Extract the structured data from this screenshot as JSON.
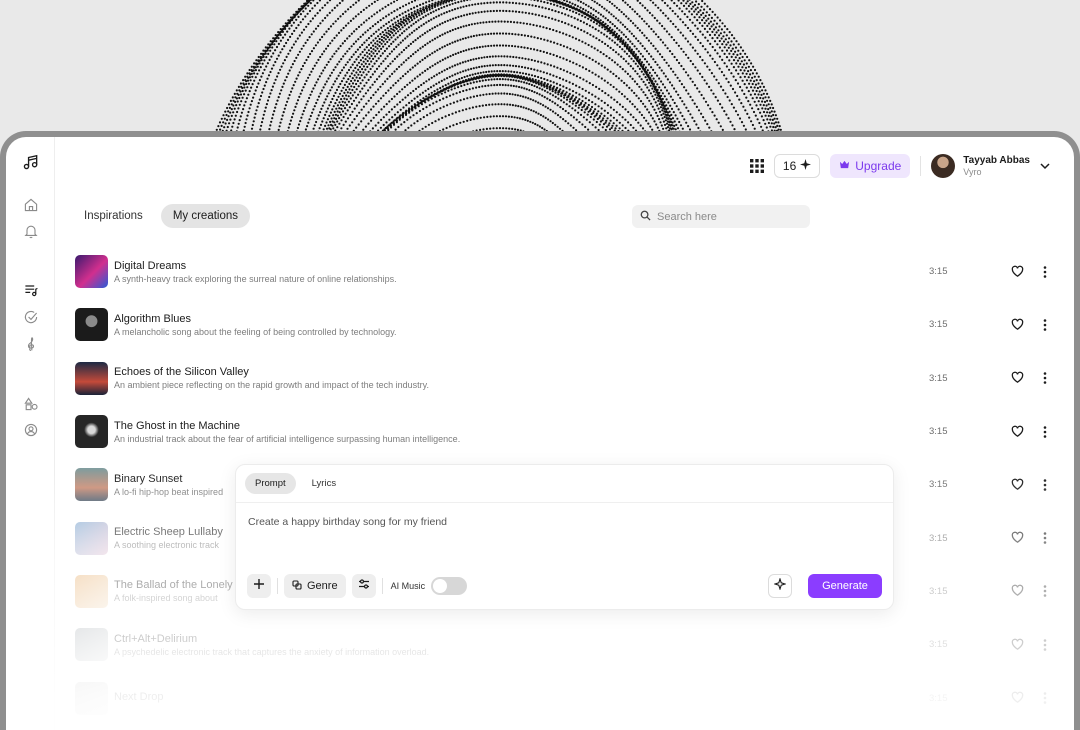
{
  "topbar": {
    "credits": "16",
    "upgrade_label": "Upgrade",
    "user_name": "Tayyab Abbas",
    "user_org": "Vyro"
  },
  "tabs": [
    {
      "label": "Inspirations",
      "active": false
    },
    {
      "label": "My creations",
      "active": true
    }
  ],
  "search": {
    "placeholder": "Search here"
  },
  "songs": [
    {
      "title": "Digital Dreams",
      "desc": "A synth-heavy track exploring the surreal nature of online relationships.",
      "duration": "3:15",
      "cover": "linear-gradient(135deg,#3a1a6e,#d12f8e 55%,#2a5bd7)"
    },
    {
      "title": "Algorithm Blues",
      "desc": "A melancholic song about the feeling of being controlled by technology.",
      "duration": "3:15",
      "cover": "radial-gradient(circle at 50% 40%,#8a8a8a 0 22%,#1b1b1b 24% 100%)"
    },
    {
      "title": "Echoes of the Silicon Valley",
      "desc": "An ambient piece reflecting on the rapid growth and impact of the tech industry.",
      "duration": "3:15",
      "cover": "linear-gradient(180deg,#1d2a44,#c44a3a 60%,#1a2238)"
    },
    {
      "title": "The Ghost in the Machine",
      "desc": "An industrial track about the fear of artificial intelligence surpassing human intelligence.",
      "duration": "3:15",
      "cover": "radial-gradient(circle at 50% 45%,#d8d8d8 0 15%,#262626 30% 100%)"
    },
    {
      "title": "Binary Sunset",
      "desc": "A lo-fi hip-hop beat inspired",
      "duration": "3:15",
      "cover": "linear-gradient(180deg,#7f9ea0,#c98d76 60%,#4d5b6a)"
    },
    {
      "title": "Electric Sheep Lullaby",
      "desc": "A soothing electronic track",
      "duration": "3:15",
      "cover": "linear-gradient(135deg,#8fb3d6,#e4c7d7)"
    },
    {
      "title": "The Ballad of the Lonely",
      "desc": "A folk-inspired song about",
      "duration": "3:15",
      "cover": "linear-gradient(135deg,#e8b070,#f2dcc0)"
    },
    {
      "title": "Ctrl+Alt+Delirium",
      "desc": "A psychedelic electronic track that captures the anxiety of information overload.",
      "duration": "3:15",
      "cover": "linear-gradient(135deg,#9aa2a8,#d8dadb)"
    },
    {
      "title": "Next Drop",
      "desc": "",
      "duration": "3:15",
      "cover": "linear-gradient(135deg,#b8b8b8,#e2e2e2)"
    }
  ],
  "composer": {
    "tabs": [
      {
        "label": "Prompt",
        "active": true
      },
      {
        "label": "Lyrics",
        "active": false
      }
    ],
    "prompt_value": "Create a happy birthday song for my friend",
    "genre_label": "Genre",
    "ai_music_label": "AI Music",
    "ai_music_on": false,
    "generate_label": "Generate"
  },
  "colors": {
    "accent": "#8b3dff",
    "upgrade_bg": "#efe6fd",
    "upgrade_text": "#7c3aed"
  }
}
